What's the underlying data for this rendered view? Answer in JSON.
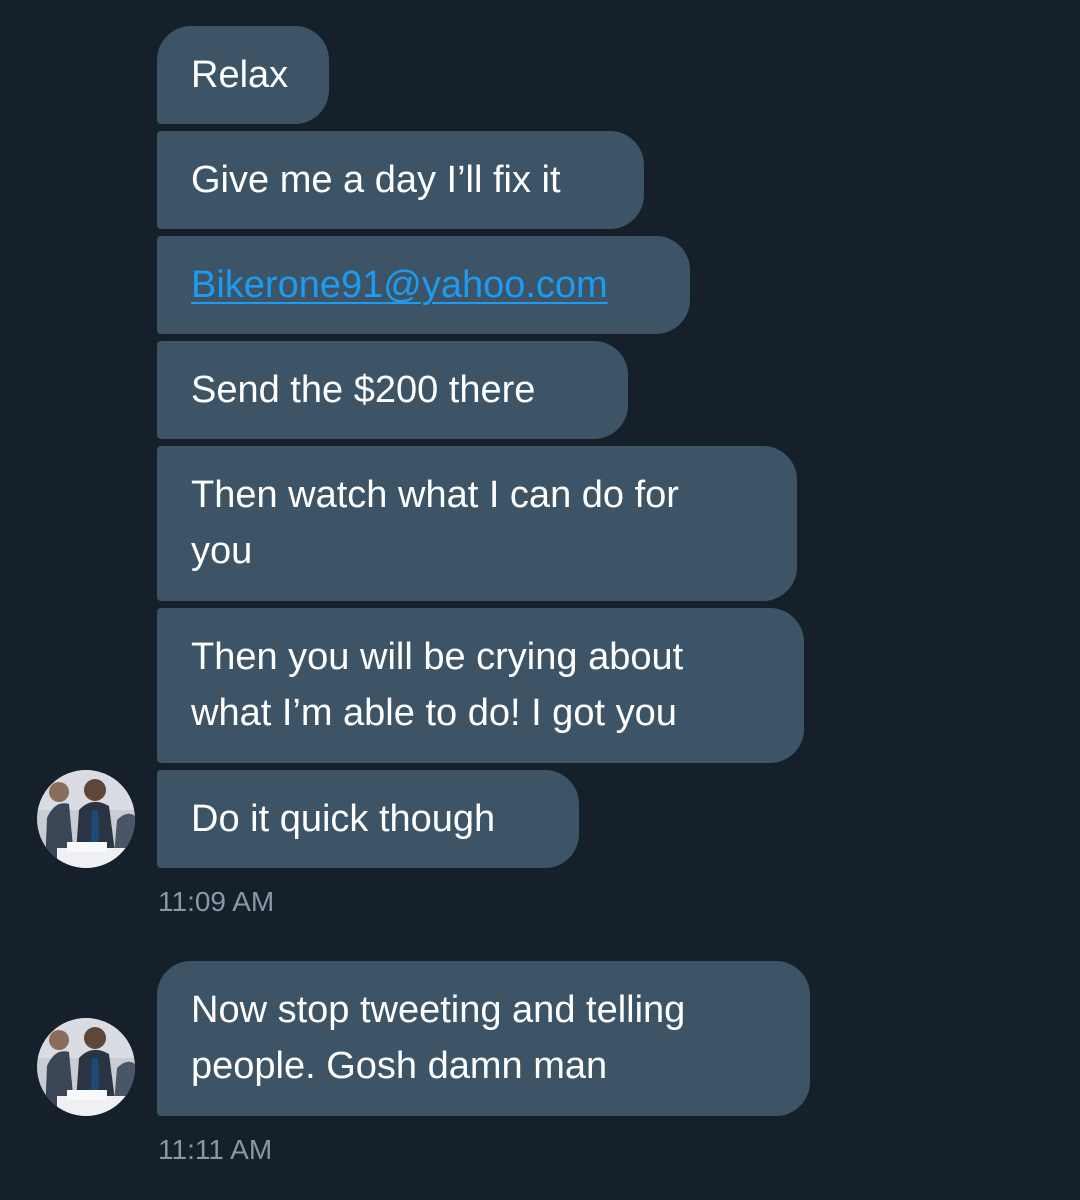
{
  "conversation": {
    "group1": {
      "messages": [
        "Relax",
        "Give me a day I’ll fix it",
        "Bikerone91@yahoo.com",
        "Send the $200 there",
        [
          "Then watch what I can do for",
          "you"
        ],
        [
          "Then you will be crying about",
          "what I’m able to do! I got you"
        ],
        "Do it quick though"
      ],
      "timestamp": "11:09 AM"
    },
    "group2": {
      "messages": [
        [
          "Now stop tweeting and telling",
          "people. Gosh damn man"
        ]
      ],
      "timestamp": "11:11 AM"
    }
  },
  "theme": {
    "background": "#15202b",
    "bubble": "#3d5466",
    "link": "#1d9bf0",
    "timestamp": "#8899a6"
  },
  "icons": {
    "avatar": "user-avatar-photo"
  }
}
